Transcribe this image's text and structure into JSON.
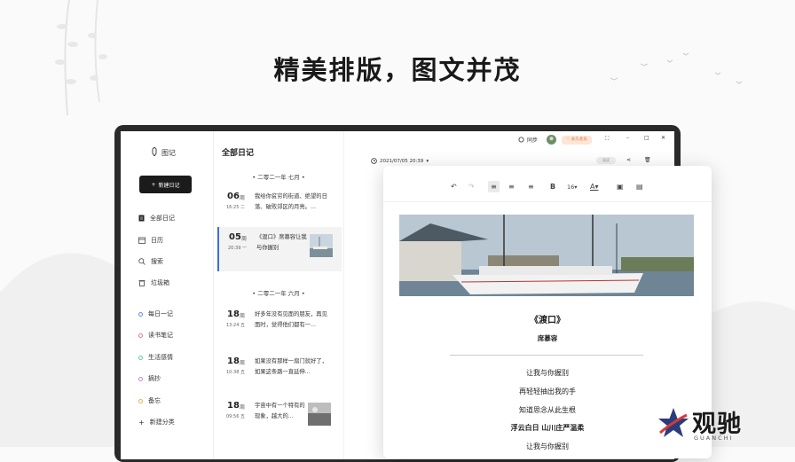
{
  "headline": "精美排版，图文并茂",
  "sidebar": {
    "app_title": "图记",
    "new_button": "新建日记",
    "nav": [
      {
        "label": "全部日记",
        "icon": "document-icon"
      },
      {
        "label": "日历",
        "icon": "calendar-icon"
      },
      {
        "label": "搜索",
        "icon": "search-icon"
      },
      {
        "label": "垃圾箱",
        "icon": "trash-icon"
      }
    ],
    "categories": [
      {
        "label": "每日一记",
        "color": "#5b8def"
      },
      {
        "label": "读书笔记",
        "color": "#ef7b7b"
      },
      {
        "label": "生活感情",
        "color": "#6cc79a"
      },
      {
        "label": "摘抄",
        "color": "#b58be0"
      },
      {
        "label": "备忘",
        "color": "#f0b24a"
      }
    ],
    "add_category": "新建分类"
  },
  "list": {
    "title": "全部日记",
    "month1": "二零二一年 七月",
    "month2": "二零二一年 六月",
    "entries": [
      {
        "day": "06",
        "weekday": "周",
        "time": "16:25 二",
        "text": "我给你贫穷的街道、绝望的日落、破败郊区的月亮。..."
      },
      {
        "day": "05",
        "weekday": "周",
        "time": "20:39 一",
        "text": "《渡口》席慕容让我与你握别"
      },
      {
        "day": "18",
        "weekday": "周",
        "time": "13:24 五",
        "text": "好多年没有见面的朋友，再见面时，觉得他们都有一..."
      },
      {
        "day": "18",
        "weekday": "周",
        "time": "10:38 五",
        "text": "如果没有那样一扇门就好了，如果这条路一直延伸..."
      },
      {
        "day": "18",
        "weekday": "周",
        "time": "09:56 五",
        "text": "宇宙中有一个特有的现象，越大的..."
      }
    ]
  },
  "editor": {
    "sync": "同步",
    "vip": "永久会员",
    "date": "2021/07/05 20:39",
    "pill": "阅读",
    "font_size": "16"
  },
  "document": {
    "title": "《渡口》",
    "author": "席慕容",
    "lines": [
      "让我与你握别",
      "再轻轻抽出我的手",
      "知道思念从此生根"
    ],
    "bold_line": "浮云白日 山川庄严温柔",
    "last_line": "让我与你握别"
  },
  "logo": {
    "cn": "观驰",
    "en": "GUANCHI"
  }
}
